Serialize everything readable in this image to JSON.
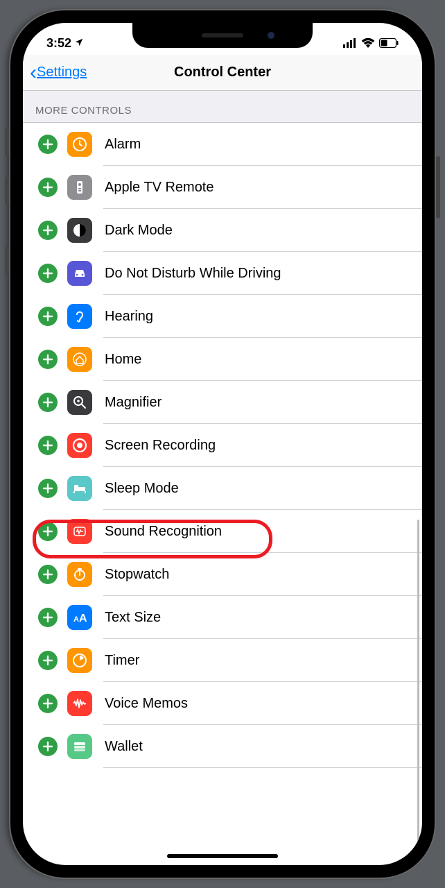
{
  "status": {
    "time": "3:52",
    "location_arrow": true
  },
  "nav": {
    "back_label": "Settings",
    "title": "Control Center"
  },
  "section_header": "MORE CONTROLS",
  "controls": [
    {
      "label": "Alarm",
      "icon": "clock-icon",
      "color": "ic-orange"
    },
    {
      "label": "Apple TV Remote",
      "icon": "remote-icon",
      "color": "ic-gray"
    },
    {
      "label": "Dark Mode",
      "icon": "darkmode-icon",
      "color": "ic-darkgray"
    },
    {
      "label": "Do Not Disturb While Driving",
      "icon": "car-icon",
      "color": "ic-indigo"
    },
    {
      "label": "Hearing",
      "icon": "ear-icon",
      "color": "ic-blue"
    },
    {
      "label": "Home",
      "icon": "home-icon",
      "color": "ic-orange"
    },
    {
      "label": "Magnifier",
      "icon": "magnifier-icon",
      "color": "ic-darkgray"
    },
    {
      "label": "Screen Recording",
      "icon": "record-icon",
      "color": "ic-red",
      "highlighted": true
    },
    {
      "label": "Sleep Mode",
      "icon": "bed-icon",
      "color": "ic-teal"
    },
    {
      "label": "Sound Recognition",
      "icon": "sound-icon",
      "color": "ic-red"
    },
    {
      "label": "Stopwatch",
      "icon": "stopwatch-icon",
      "color": "ic-orange"
    },
    {
      "label": "Text Size",
      "icon": "textsize-icon",
      "color": "ic-blue"
    },
    {
      "label": "Timer",
      "icon": "timer-icon",
      "color": "ic-orange"
    },
    {
      "label": "Voice Memos",
      "icon": "voicememo-icon",
      "color": "ic-red"
    },
    {
      "label": "Wallet",
      "icon": "wallet-icon",
      "color": "ic-green"
    }
  ]
}
